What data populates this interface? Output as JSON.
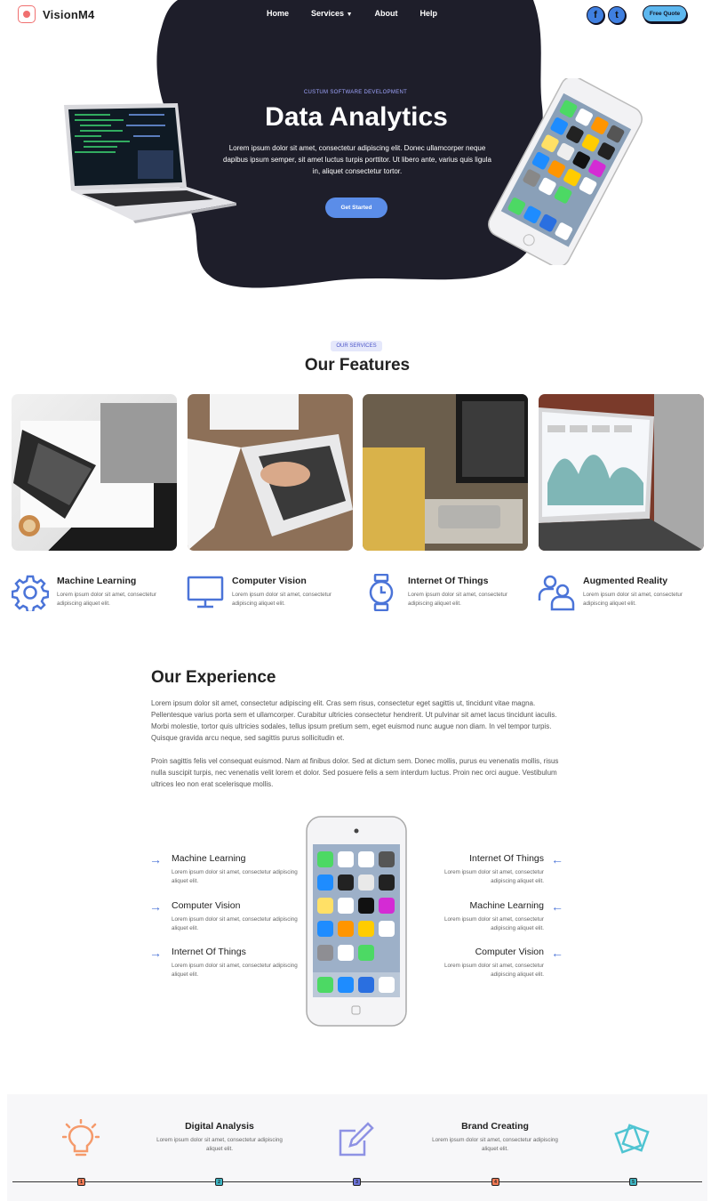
{
  "brand": {
    "name": "VisionM4"
  },
  "nav": {
    "items": [
      "Home",
      "Services",
      "About",
      "Help"
    ]
  },
  "social": {
    "facebook": "f",
    "twitter": "t"
  },
  "header": {
    "quote_button": "Free Quote"
  },
  "hero": {
    "subtitle": "CUSTUM SOFTWARE DEVELOPMENT",
    "title": "Data Analytics",
    "text": "Lorem ipsum dolor sit amet, consectetur adipiscing elit. Donec ullamcorper neque dapibus ipsum semper, sit amet luctus turpis porttitor. Ut libero ante, varius quis ligula in, aliquet consectetur tortor.",
    "cta": "Get Started"
  },
  "features": {
    "pill": "OUR SERVICES",
    "title": "Our Features",
    "items": [
      {
        "title": "Machine Learning",
        "text": "Lorem ipsum dolor sit amet, consectetur adipiscing aliquet elit.",
        "icon": "gear-icon"
      },
      {
        "title": "Computer Vision",
        "text": "Lorem ipsum dolor sit amet, consectetur adipiscing aliquet elit.",
        "icon": "monitor-icon"
      },
      {
        "title": "Internet Of Things",
        "text": "Lorem ipsum dolor sit amet, consectetur adipiscing aliquet elit.",
        "icon": "watch-icon"
      },
      {
        "title": "Augmented Reality",
        "text": "Lorem ipsum dolor sit amet, consectetur adipiscing aliquet elit.",
        "icon": "users-icon"
      }
    ]
  },
  "experience": {
    "title": "Our Experience",
    "p1": "Lorem ipsum dolor sit amet, consectetur adipiscing elit. Cras sem risus, consectetur eget sagittis ut, tincidunt vitae magna. Pellentesque varius porta sem et ullamcorper. Curabitur ultricies consectetur hendrerit. Ut pulvinar sit amet lacus tincidunt iaculis. Morbi molestie, tortor quis ultricies sodales, tellus ipsum pretium sem, eget euismod nunc augue non diam. In vel tempor turpis. Quisque gravida arcu neque, sed sagittis purus sollicitudin et.",
    "p2": "Proin sagittis felis vel consequat euismod. Nam at finibus dolor. Sed at dictum sem. Donec mollis, purus eu venenatis mollis, risus nulla suscipit turpis, nec venenatis velit lorem et dolor. Sed posuere felis a sem interdum luctus. Proin nec orci augue. Vestibulum ultrices leo non erat scelerisque mollis.",
    "left": [
      {
        "title": "Machine Learning",
        "text": "Lorem ipsum dolor sit amet, consectetur adipiscing aliquet elit."
      },
      {
        "title": "Computer Vision",
        "text": "Lorem ipsum dolor sit amet, consectetur adipiscing aliquet elit."
      },
      {
        "title": "Internet Of Things",
        "text": "Lorem ipsum dolor sit amet, consectetur adipiscing aliquet elit."
      }
    ],
    "right": [
      {
        "title": "Internet Of Things",
        "text": "Lorem ipsum dolor sit amet, consectetur adipiscing aliquet elit."
      },
      {
        "title": "Machine Learning",
        "text": "Lorem ipsum dolor sit amet, consectetur adipiscing aliquet elit."
      },
      {
        "title": "Computer Vision",
        "text": "Lorem ipsum dolor sit amet, consectetur adipiscing aliquet elit."
      }
    ]
  },
  "process": {
    "items": [
      {
        "title": "Digital Analysis",
        "text": "Lorem ipsum dolor sit amet, consectetur adipiscing aliquet elit."
      },
      {
        "title": "Brand Creating",
        "text": "Lorem ipsum dolor sit amet, consectetur adipiscing aliquet elit."
      }
    ],
    "steps": [
      "1",
      "2",
      "3",
      "4",
      "5"
    ],
    "step_colors": [
      "#f07a55",
      "#3fb6c4",
      "#6b72d8",
      "#f07a55",
      "#3fb6c4"
    ]
  },
  "colors": {
    "dark": "#1e1e2a",
    "accent": "#5b8de8",
    "coral": "#f07070"
  }
}
